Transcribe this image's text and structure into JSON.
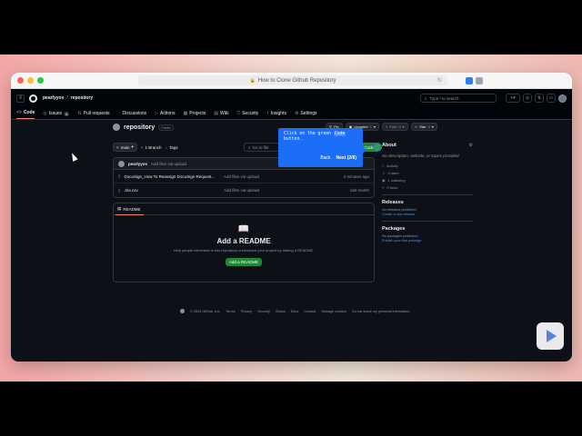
{
  "browser": {
    "tab_title": "How to Clone Github Repository"
  },
  "header": {
    "owner": "pearlyyov",
    "repo": "repository",
    "search_placeholder": "Type / to search"
  },
  "tabs": [
    {
      "label": "Code",
      "icon": "code-icon"
    },
    {
      "label": "Issues",
      "icon": "issue-icon",
      "count": "8"
    },
    {
      "label": "Pull requests",
      "icon": "pull-request-icon"
    },
    {
      "label": "Discussions",
      "icon": "discussion-icon"
    },
    {
      "label": "Actions",
      "icon": "play-icon"
    },
    {
      "label": "Projects",
      "icon": "table-icon"
    },
    {
      "label": "Wiki",
      "icon": "book-icon"
    },
    {
      "label": "Security",
      "icon": "shield-icon"
    },
    {
      "label": "Insights",
      "icon": "graph-icon"
    },
    {
      "label": "Settings",
      "icon": "gear-icon"
    }
  ],
  "repo": {
    "name": "repository",
    "visibility": "Public",
    "pin": "Pin",
    "unwatch": "Unwatch",
    "unwatch_count": "1",
    "fork": "Fork",
    "fork_count": "0",
    "star": "Star",
    "star_count": "0"
  },
  "branch": {
    "name": "main",
    "branches": "1 Branch",
    "tags": "Tags",
    "goto_file": "Go to file",
    "code": "Code"
  },
  "commit": {
    "user": "pearlyyov",
    "message": "Add files via upload"
  },
  "files": [
    {
      "name": "DocuSign_How To Reassign DocuSign Request...",
      "commit": "Add files via upload",
      "time": "4 minutes ago"
    },
    {
      "name": "Jira.csv",
      "commit": "Add files via upload",
      "time": "last month"
    }
  ],
  "readme": {
    "tab": "README",
    "title": "Add a README",
    "description": "Help people interested in this repository understand your project by adding a README.",
    "button": "Add a README"
  },
  "sidebar": {
    "about": "About",
    "description": "No description, website, or topics provided.",
    "stats": [
      "Activity",
      "0 stars",
      "1 watching",
      "0 forks"
    ],
    "releases_title": "Releases",
    "releases_text": "No releases published",
    "releases_link": "Create a new release",
    "packages_title": "Packages",
    "packages_text": "No packages published",
    "packages_link": "Publish your first package"
  },
  "footer": {
    "copyright": "© 2024 GitHub, Inc.",
    "links": [
      "Terms",
      "Privacy",
      "Security",
      "Status",
      "Docs",
      "Contact",
      "Manage cookies",
      "Do not share my personal information"
    ]
  },
  "tooltip": {
    "line1": "Click on the green ",
    "code_word": "Code",
    "line2": "button.",
    "back": "Back",
    "next": "Next (2/8)"
  }
}
